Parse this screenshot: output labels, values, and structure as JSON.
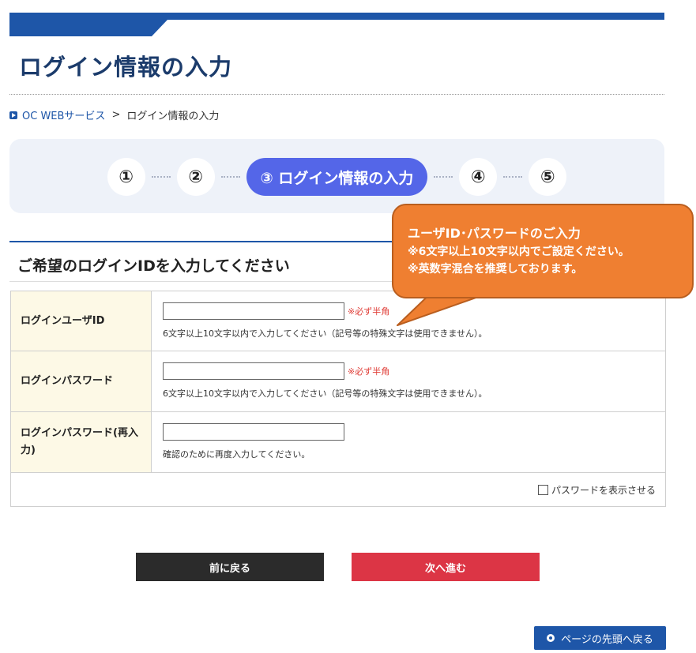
{
  "page": {
    "title": "ログイン情報の入力",
    "brand_color": "#1e56a8"
  },
  "breadcrumb": {
    "home": "OC WEBサービス",
    "separator": ">",
    "current": "ログイン情報の入力"
  },
  "steps": {
    "step1": "①",
    "step2": "②",
    "step3_active": "③ ログイン情報の入力",
    "step4": "④",
    "step5": "⑤",
    "active_color": "#5466e8"
  },
  "section": {
    "heading": "ご希望のログインIDを入力してください"
  },
  "form": {
    "user_id": {
      "label": "ログインユーザID",
      "required": "※必ず半角",
      "hint": "6文字以上10文字以内で入力してください（記号等の特殊文字は使用できません）。",
      "value": ""
    },
    "password": {
      "label": "ログインパスワード",
      "required": "※必ず半角",
      "hint": "6文字以上10文字以内で入力してください（記号等の特殊文字は使用できません）。",
      "value": ""
    },
    "password_confirm": {
      "label": "ログインパスワード(再入力)",
      "hint": "確認のために再度入力してください。",
      "value": ""
    },
    "show_password_label": "パスワードを表示させる"
  },
  "callout": {
    "title": "ユーザID･パスワードのご入力",
    "line1": "※6文字以上10文字以内でご設定ください。",
    "line2": "※英数字混合を推奨しております。",
    "color": "#ef7f31"
  },
  "buttons": {
    "back": "前に戻る",
    "next": "次へ進む",
    "page_top": "ページの先頭へ戻る"
  }
}
